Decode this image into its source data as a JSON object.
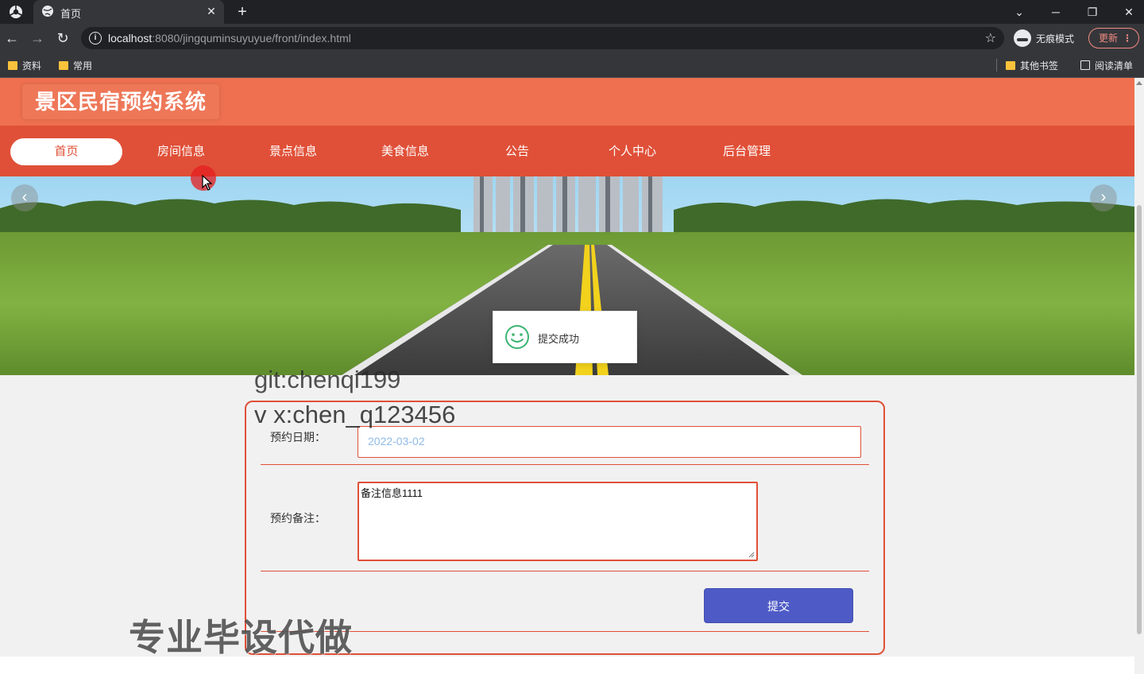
{
  "browser": {
    "tab_title": "首页",
    "url_host": "localhost",
    "url_rest": ":8080/jingquminsuyuyue/front/index.html",
    "incognito_label": "无痕模式",
    "update_label": "更新",
    "bookmarks": [
      {
        "label": "资料"
      },
      {
        "label": "常用"
      }
    ],
    "other_bookmarks_label": "其他书签",
    "reading_list_label": "阅读清单"
  },
  "site": {
    "title": "景区民宿预约系统",
    "nav": [
      {
        "label": "首页",
        "active": true
      },
      {
        "label": "房间信息",
        "active": false
      },
      {
        "label": "景点信息",
        "active": false
      },
      {
        "label": "美食信息",
        "active": false
      },
      {
        "label": "公告",
        "active": false
      },
      {
        "label": "个人中心",
        "active": false
      },
      {
        "label": "后台管理",
        "active": false
      }
    ]
  },
  "toast": {
    "message": "提交成功",
    "icon": "smile-icon"
  },
  "form": {
    "date_label": "预约日期：",
    "date_value": "2022-03-02",
    "notes_label": "预约备注：",
    "notes_value": "备注信息1111",
    "submit_label": "提交"
  },
  "watermarks": {
    "git": "git:chenqi199",
    "vx": "v x:chen_q123456",
    "ad": "专业毕设代做"
  },
  "colors": {
    "header": "#ee7050",
    "nav": "#e05038",
    "submit": "#4e5bc6"
  }
}
